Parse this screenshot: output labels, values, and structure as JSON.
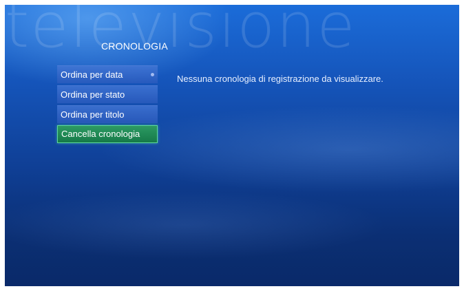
{
  "background_watermark": "televisione",
  "section_title": "CRONOLOGIA",
  "menu": {
    "items": [
      {
        "label": "Ordina per data",
        "has_indicator": true
      },
      {
        "label": "Ordina per stato"
      },
      {
        "label": "Ordina per titolo"
      },
      {
        "label": "Cancella cronologia",
        "selected": true
      }
    ]
  },
  "message": "Nessuna cronologia di registrazione da visualizzare.",
  "colors": {
    "background_top": "#1b6cd9",
    "background_bottom": "#0a2a68",
    "menu_item": "#3a6fd0",
    "selected_item": "#1e8a55",
    "selected_border": "#5fd99a"
  }
}
